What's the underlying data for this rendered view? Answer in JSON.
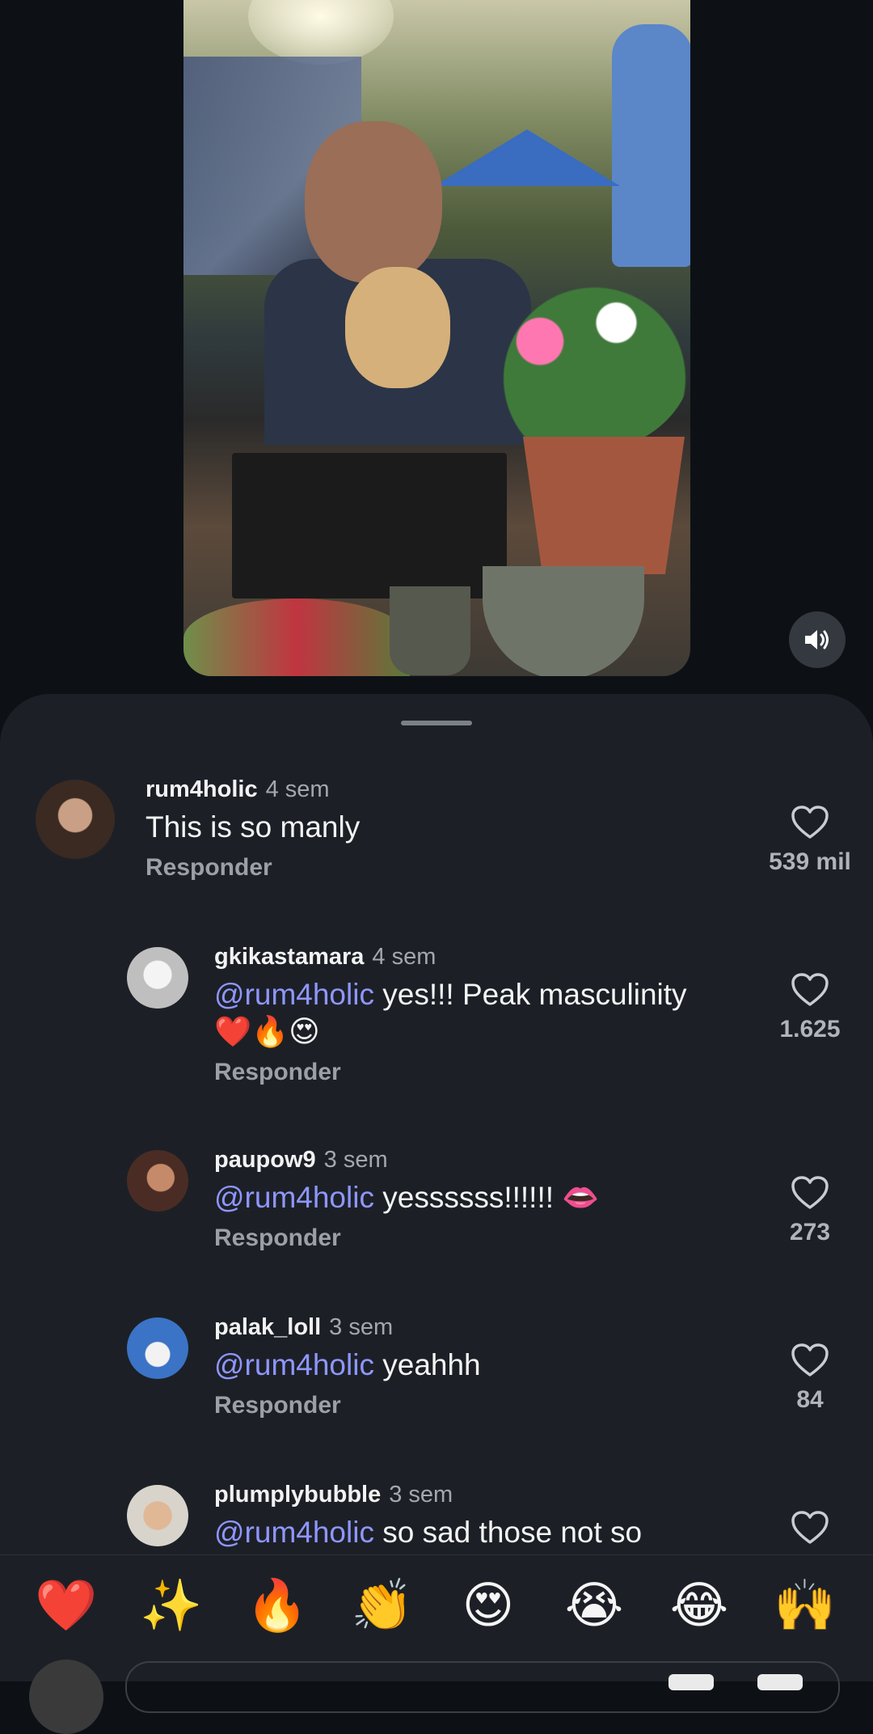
{
  "video": {
    "sound_icon": "speaker-volume-icon"
  },
  "comments": [
    {
      "user": "rum4holic",
      "time": "4 sem",
      "mention": "",
      "text": "This is so manly",
      "emoji": "",
      "reply": "Responder",
      "likes": "539 mil"
    },
    {
      "user": "gkikastamara",
      "time": "4 sem",
      "mention": "@rum4holic",
      "text": " yes!!! Peak masculinity",
      "emoji": "❤️🔥😍",
      "reply": "Responder",
      "likes": "1.625"
    },
    {
      "user": "paupow9",
      "time": "3 sem",
      "mention": "@rum4holic",
      "text": " yessssss!!!!!! 👄",
      "emoji": "",
      "reply": "Responder",
      "likes": "273"
    },
    {
      "user": "palak_loll",
      "time": "3 sem",
      "mention": "@rum4holic",
      "text": " yeahhh",
      "emoji": "",
      "reply": "Responder",
      "likes": "84"
    },
    {
      "user": "plumplybubble",
      "time": "3 sem",
      "mention": "@rum4holic",
      "text": " so sad those not so",
      "emoji": "",
      "reply": "",
      "likes": ""
    }
  ],
  "emoji_bar": [
    "❤️",
    "✨",
    "🔥",
    "👏",
    "😍",
    "😭",
    "😂",
    "🙌"
  ],
  "colors": {
    "background": "#0d1116",
    "sheet": "#1c2026",
    "mention": "#8f96ff"
  }
}
